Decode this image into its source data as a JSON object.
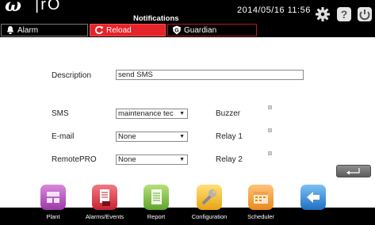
{
  "header": {
    "logo": "ω",
    "logo_suffix": "|rO",
    "title": "Notifications",
    "datetime": "2014/05/16  11:56"
  },
  "tabs": [
    {
      "label": "Alarm",
      "icon": "bell-icon",
      "active": false
    },
    {
      "label": "Reload",
      "icon": "refresh-icon",
      "active": true
    },
    {
      "label": "Guardian",
      "icon": "shield-icon",
      "active": false
    }
  ],
  "form": {
    "description_label": "Description",
    "description_value": "send SMS",
    "sms_label": "SMS",
    "sms_value": "maintenance tec",
    "email_label": "E-mail",
    "email_value": "None",
    "remotepro_label": "RemotePRO",
    "remotepro_value": "None",
    "buzzer_label": "Buzzer",
    "relay1_label": "Relay 1",
    "relay2_label": "Relay 2"
  },
  "nav": [
    {
      "label": "Plant",
      "icon": "plant-icon",
      "color": "#b04fb8"
    },
    {
      "label": "Alarms/Events",
      "icon": "alarm-doc-icon",
      "color": "#e03a4b"
    },
    {
      "label": "Report",
      "icon": "report-icon",
      "color": "#7cc13f"
    },
    {
      "label": "Configuration",
      "icon": "wrench-icon",
      "color": "#f2b91e"
    },
    {
      "label": "Scheduler",
      "icon": "calendar-icon",
      "color": "#f39a2e"
    },
    {
      "label": "",
      "icon": "back-arrow-icon",
      "color": "#2f86d6"
    }
  ],
  "colors": {
    "accent_red": "#e4232b",
    "header_bg": "#000000"
  }
}
